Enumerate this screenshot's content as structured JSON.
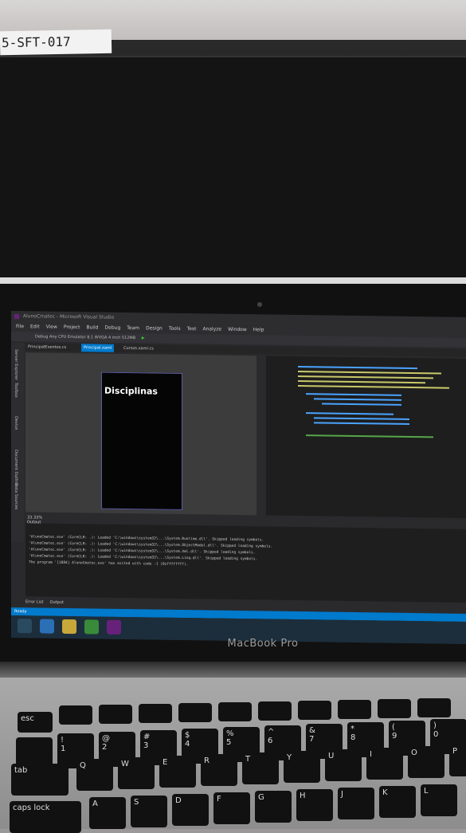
{
  "asset_tag": "5-SFT-017",
  "laptop_brand": "MacBook Pro",
  "vs": {
    "title": "AlunoCmatec - Microsoft Visual Studio",
    "menu": [
      "File",
      "Edit",
      "View",
      "Project",
      "Build",
      "Debug",
      "Team",
      "Design",
      "Tools",
      "Test",
      "Analyze",
      "Window",
      "Help"
    ],
    "toolbar": "Debug  Any CPU  Emulator 8.1 WVGA 4 inch 512MB",
    "tabs": [
      "PrincipalEventos.cs",
      "Principal.xaml",
      "Cursos.xaml.cs"
    ],
    "side_panels": [
      "Server Explorer",
      "Toolbox",
      "Device",
      "Document Outline",
      "Data Sources"
    ],
    "phone_app_title": "Disciplinas",
    "zoom": "33.33%",
    "output_title": "Output",
    "output_lines": [
      "'AlunoCmatec.exe' (CoreCLR: .): Loaded 'C:\\windows\\system32\\...\\System.Runtime.dll'. Skipped loading symbols.",
      "'AlunoCmatec.exe' (CoreCLR: .): Loaded 'C:\\windows\\system32\\...\\System.ObjectModel.dll'. Skipped loading symbols.",
      "'AlunoCmatec.exe' (CoreCLR: .): Loaded 'C:\\windows\\system32\\...\\System.Xml.dll'. Skipped loading symbols.",
      "'AlunoCmatec.exe' (CoreCLR: .): Loaded 'C:\\windows\\system32\\...\\System.Linq.dll'. Skipped loading symbols.",
      "The program '[1884] AlunoCmatec.exe' has exited with code -1 (0xffffffff)."
    ],
    "bottom_tabs": [
      "Error List",
      "Output"
    ],
    "status": "Ready"
  },
  "keys": {
    "row_num": [
      "!\n1",
      "@\n2",
      "#\n3",
      "$\n4",
      "%\n5",
      "^\n6",
      "&\n7",
      "*\n8",
      "(\n9",
      ")\n0"
    ],
    "row_q": [
      "Q",
      "W",
      "E",
      "R",
      "T",
      "Y",
      "U",
      "I",
      "O",
      "P"
    ],
    "row_a": [
      "A",
      "S",
      "D",
      "F",
      "G",
      "H",
      "J",
      "K",
      "L"
    ],
    "esc": "esc",
    "tab": "tab",
    "caps": "caps lock"
  }
}
